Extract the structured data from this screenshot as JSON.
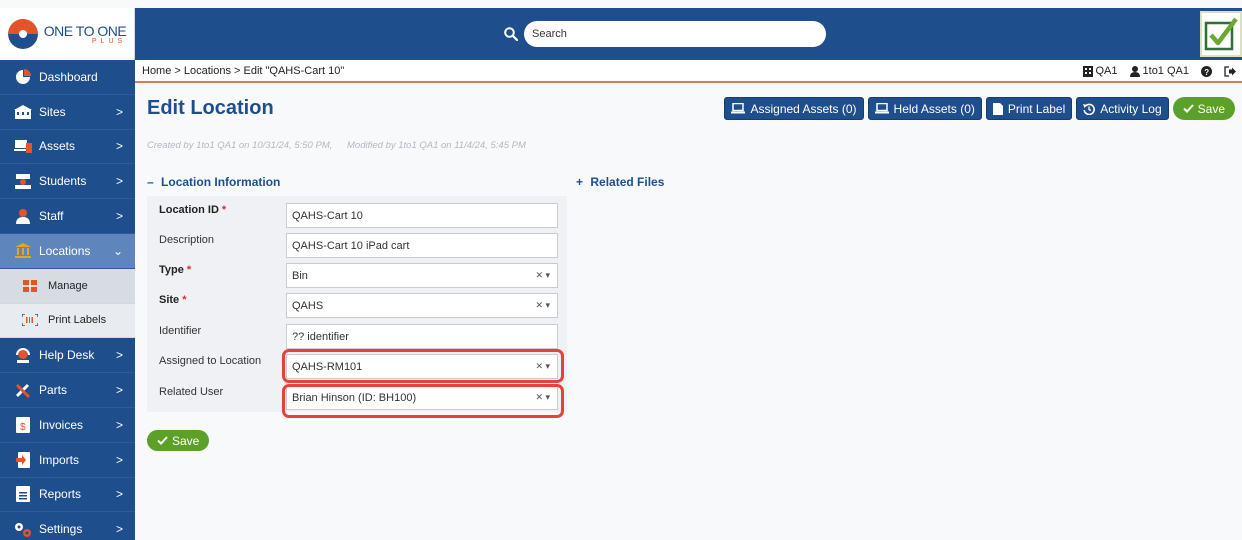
{
  "brand": {
    "logo_main": "ONE TO ONE",
    "logo_sub": "PLUS"
  },
  "search": {
    "placeholder": "Search"
  },
  "breadcrumb": "Home > Locations > Edit \"QAHS-Cart 10\"",
  "userbar": {
    "org": "QA1",
    "user": "1to1 QA1"
  },
  "sidebar": {
    "items": [
      {
        "label": "Dashboard",
        "icon": "dashboard-icon"
      },
      {
        "label": "Sites",
        "icon": "sites-icon"
      },
      {
        "label": "Assets",
        "icon": "assets-icon"
      },
      {
        "label": "Students",
        "icon": "students-icon"
      },
      {
        "label": "Staff",
        "icon": "staff-icon"
      },
      {
        "label": "Locations",
        "icon": "locations-icon"
      },
      {
        "label": "Help Desk",
        "icon": "help-desk-icon"
      },
      {
        "label": "Parts",
        "icon": "parts-icon"
      },
      {
        "label": "Invoices",
        "icon": "invoices-icon"
      },
      {
        "label": "Imports",
        "icon": "imports-icon"
      },
      {
        "label": "Reports",
        "icon": "reports-icon"
      },
      {
        "label": "Settings",
        "icon": "settings-icon"
      }
    ],
    "locations_sub": [
      {
        "label": "Manage",
        "icon": "manage-grid-icon"
      },
      {
        "label": "Print Labels",
        "icon": "barcode-icon"
      }
    ]
  },
  "page": {
    "title": "Edit Location",
    "created": "Created by 1to1 QA1 on 10/31/24, 5:50 PM,",
    "modified": "Modified by 1to1 QA1 on 11/4/24, 5:45 PM"
  },
  "actions": {
    "assigned_assets": "Assigned Assets (0)",
    "held_assets": "Held Assets (0)",
    "print_label": "Print Label",
    "activity_log": "Activity Log",
    "save": "Save"
  },
  "sections": {
    "location_info": "Location Information",
    "related_files": "Related Files"
  },
  "form": {
    "location_id": {
      "label": "Location ID",
      "value": "QAHS-Cart 10"
    },
    "description": {
      "label": "Description",
      "value": "QAHS-Cart 10 iPad cart"
    },
    "type": {
      "label": "Type",
      "value": "Bin"
    },
    "site": {
      "label": "Site",
      "value": "QAHS"
    },
    "identifier": {
      "label": "Identifier",
      "value": "?? identifier"
    },
    "assigned_location": {
      "label": "Assigned to Location",
      "value": "QAHS-RM101"
    },
    "related_user": {
      "label": "Related User",
      "value": "Brian Hinson (ID: BH100)"
    }
  },
  "bottom_save": "Save",
  "colors": {
    "primary": "#1f4e8c",
    "save_green": "#5aa029",
    "highlight": "#e8403a",
    "accent_orange": "#e4532a"
  }
}
